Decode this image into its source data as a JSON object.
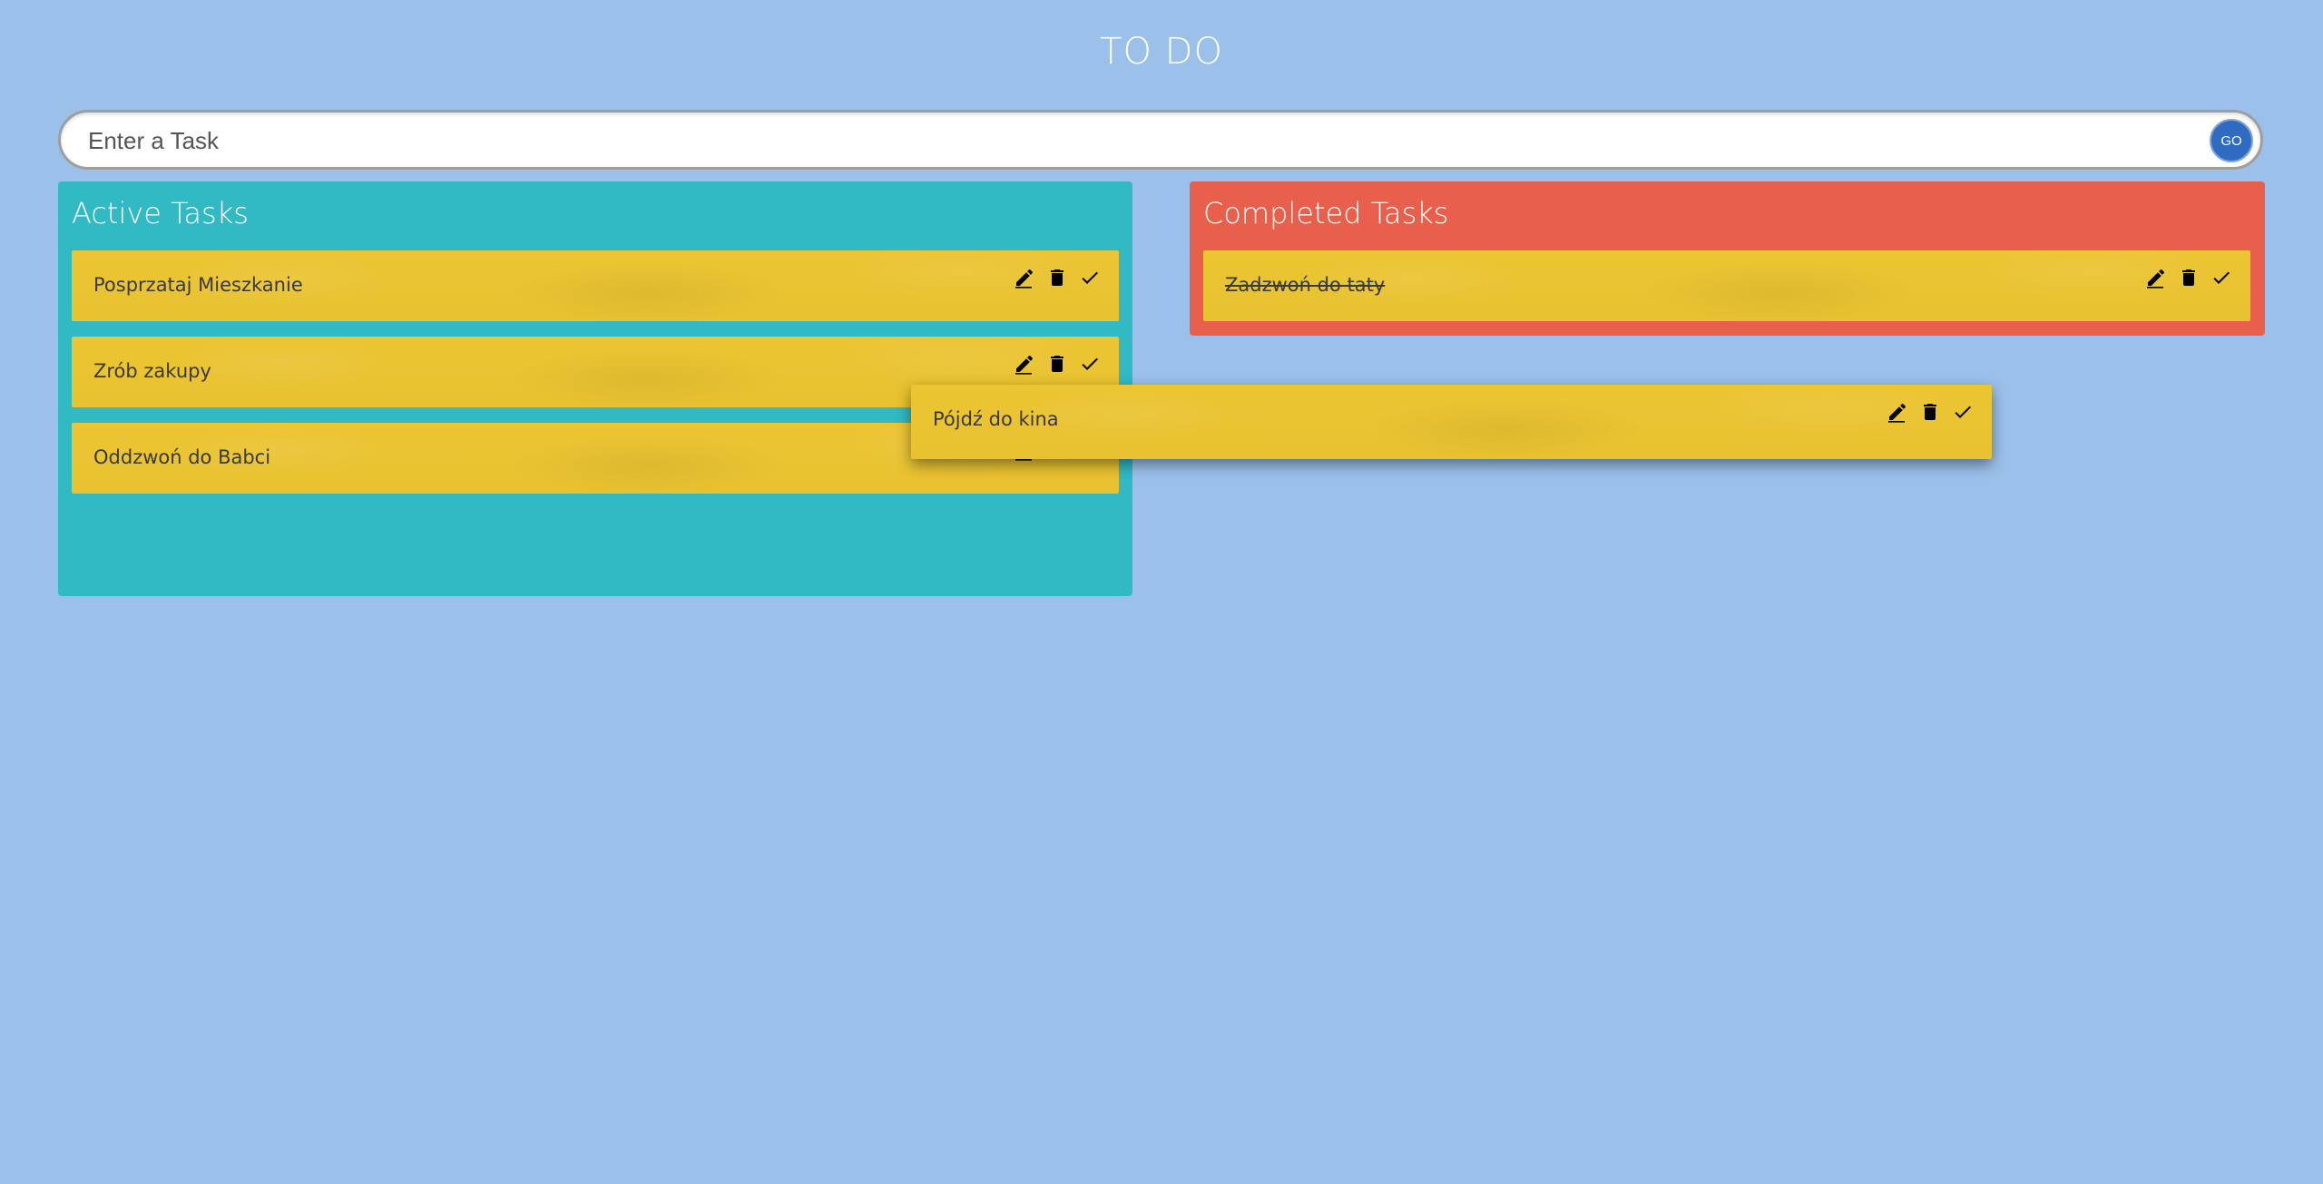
{
  "header": {
    "title": "TO DO"
  },
  "task_entry": {
    "placeholder": "Enter a Task",
    "value": "",
    "go_label": "GO"
  },
  "active": {
    "title": "Active Tasks",
    "tasks": [
      {
        "label": "Posprzataj Mieszkanie"
      },
      {
        "label": "Zrób zakupy"
      },
      {
        "label": "Oddzwoń do Babci"
      }
    ]
  },
  "completed": {
    "title": "Completed Tasks",
    "tasks": [
      {
        "label": "Zadzwoń do taty"
      }
    ]
  },
  "dragging_task": {
    "label": "Pójdź do kina"
  },
  "icons": {
    "edit": "pencil-icon",
    "delete": "trash-icon",
    "complete": "check-icon"
  },
  "colors": {
    "background": "#9bc1ea",
    "active_panel": "#31b9c4",
    "completed_panel": "#e8604c",
    "card": "#ecc533",
    "go_button": "#2f6bc0"
  }
}
